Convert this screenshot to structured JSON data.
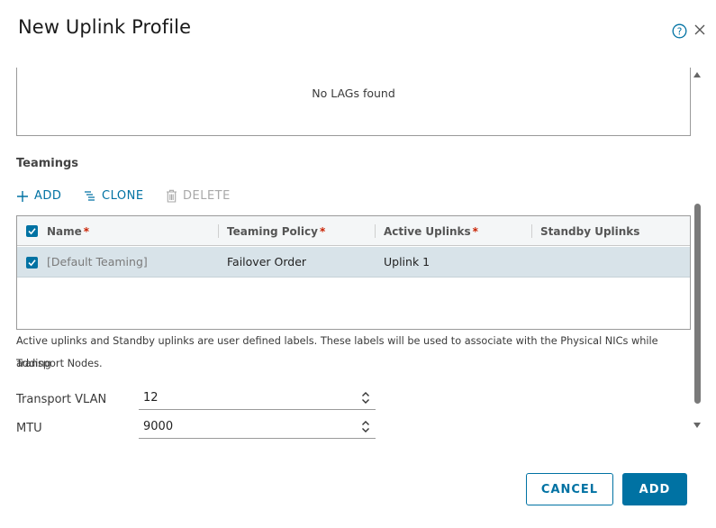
{
  "dialog": {
    "title": "New Uplink Profile"
  },
  "lags": {
    "empty_message": "No LAGs found"
  },
  "teamings": {
    "section_title": "Teamings",
    "toolbar": {
      "add_label": "ADD",
      "clone_label": "CLONE",
      "delete_label": "DELETE"
    },
    "columns": [
      {
        "label": "Name",
        "required": true
      },
      {
        "label": "Teaming Policy",
        "required": true
      },
      {
        "label": "Active Uplinks",
        "required": true
      },
      {
        "label": "Standby Uplinks",
        "required": false
      }
    ],
    "required_marker": "*",
    "rows": [
      {
        "name": "[Default Teaming]",
        "policy": "Failover Order",
        "active_uplinks": "Uplink 1",
        "standby_uplinks": "",
        "selected": true
      }
    ],
    "help_text_line1": "Active uplinks and Standby uplinks are user defined labels. These labels will be used to associate with the Physical NICs while adding",
    "help_text_line2": "Transport Nodes."
  },
  "fields": {
    "transport_vlan": {
      "label": "Transport VLAN",
      "value": "12"
    },
    "mtu": {
      "label": "MTU",
      "value": "9000"
    }
  },
  "footer": {
    "cancel_label": "CANCEL",
    "submit_label": "ADD"
  },
  "icons": {
    "help": "help-circle-icon",
    "close": "close-icon",
    "add": "plus-icon",
    "clone": "clone-icon",
    "delete": "trash-icon",
    "stepper": "chevron-up-down-icon"
  },
  "colors": {
    "accent": "#0072a3",
    "selected_row": "#d8e3e9",
    "required": "#c92100",
    "disabled": "#a8a8a8"
  }
}
